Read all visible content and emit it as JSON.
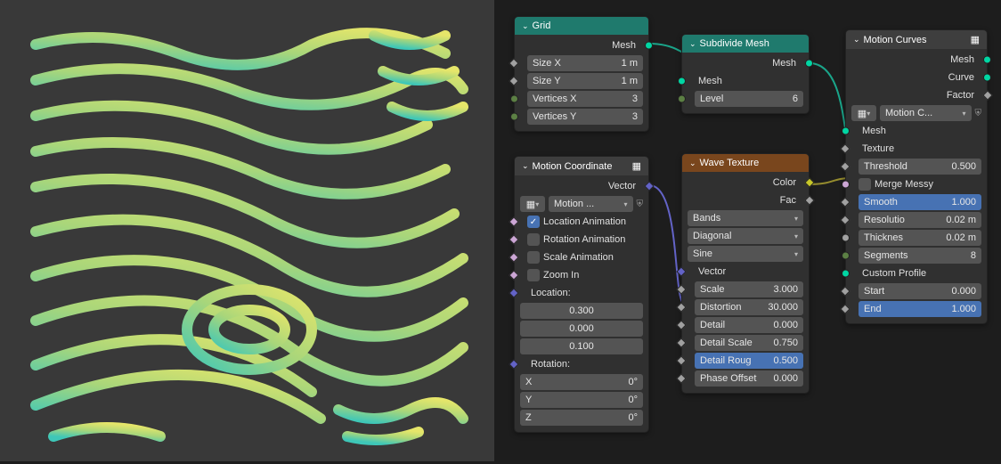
{
  "grid": {
    "title": "Grid",
    "out_mesh": "Mesh",
    "size_x_label": "Size X",
    "size_x_val": "1 m",
    "size_y_label": "Size Y",
    "size_y_val": "1 m",
    "verts_x_label": "Vertices X",
    "verts_x_val": "3",
    "verts_y_label": "Vertices Y",
    "verts_y_val": "3"
  },
  "subdivide": {
    "title": "Subdivide Mesh",
    "out_mesh": "Mesh",
    "in_mesh": "Mesh",
    "level_label": "Level",
    "level_val": "6"
  },
  "motion_coords": {
    "title": "Motion Coordinate",
    "out_vector": "Vector",
    "preset": "Motion ...",
    "loc_anim": "Location Animation",
    "rot_anim": "Rotation Animation",
    "scale_anim": "Scale Animation",
    "zoom_in": "Zoom In",
    "location_label": "Location:",
    "loc_x": "0.300",
    "loc_y": "0.000",
    "loc_z": "0.100",
    "rotation_label": "Rotation:",
    "rot_x_label": "X",
    "rot_x_val": "0°",
    "rot_y_label": "Y",
    "rot_y_val": "0°",
    "rot_z_label": "Z",
    "rot_z_val": "0°"
  },
  "wave": {
    "title": "Wave Texture",
    "out_color": "Color",
    "out_fac": "Fac",
    "type": "Bands",
    "direction": "Diagonal",
    "profile": "Sine",
    "in_vector": "Vector",
    "scale_label": "Scale",
    "scale_val": "3.000",
    "distortion_label": "Distortion",
    "distortion_val": "30.000",
    "detail_label": "Detail",
    "detail_val": "0.000",
    "detail_scale_label": "Detail Scale",
    "detail_scale_val": "0.750",
    "detail_rough_label": "Detail Roug",
    "detail_rough_val": "0.500",
    "phase_label": "Phase Offset",
    "phase_val": "0.000"
  },
  "motion_curves": {
    "title": "Motion Curves",
    "out_mesh": "Mesh",
    "out_curve": "Curve",
    "out_factor": "Factor",
    "preset": "Motion C...",
    "in_mesh": "Mesh",
    "in_texture": "Texture",
    "thresh_label": "Threshold",
    "thresh_val": "0.500",
    "merge_label": "Merge Messy",
    "smooth_label": "Smooth",
    "smooth_val": "1.000",
    "res_label": "Resolutio",
    "res_val": "0.02 m",
    "thick_label": "Thicknes",
    "thick_val": "0.02 m",
    "seg_label": "Segments",
    "seg_val": "8",
    "profile_label": "Custom Profile",
    "start_label": "Start",
    "start_val": "0.000",
    "end_label": "End",
    "end_val": "1.000"
  }
}
